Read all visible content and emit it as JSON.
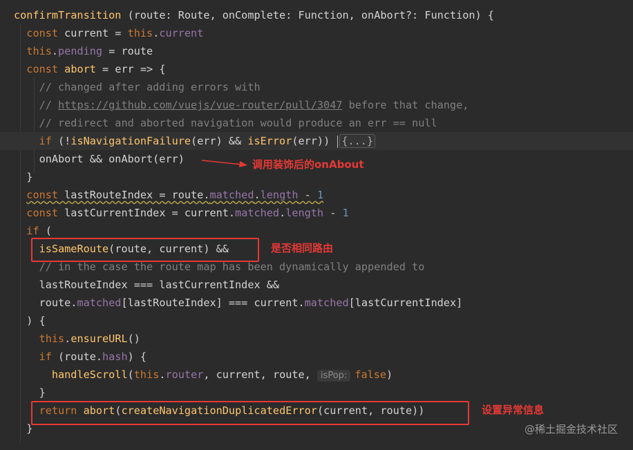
{
  "code_lines": [
    "confirmTransition (route: Route, onComplete: Function, onAbort?: Function) {",
    "  const current = this.current",
    "  this.pending = route",
    "  const abort = err => {",
    "    // changed after adding errors with",
    "    // https://github.com/vuejs/vue-router/pull/3047 before that change,",
    "    // redirect and aborted navigation would produce an err == null",
    "    if (!isNavigationFailure(err) && isError(err)) {...}",
    "    onAbort && onAbort(err)",
    "  }",
    "  const lastRouteIndex = route.matched.length - 1",
    "  const lastCurrentIndex = current.matched.length - 1",
    "  if (",
    "    isSameRoute(route, current) &&",
    "    // in the case the route map has been dynamically appended to",
    "    lastRouteIndex === lastCurrentIndex &&",
    "    route.matched[lastRouteIndex] === current.matched[lastCurrentIndex]",
    "  ) {",
    "    this.ensureURL()",
    "    if (route.hash) {",
    "      handleScroll(this.router, current, route, isPop: false)",
    "    }",
    "    return abort(createNavigationDuplicatedError(current, route))",
    "  }"
  ],
  "annotations": {
    "on_abort": "调用装饰后的onAbout",
    "same_route": "是否相同路由",
    "set_error": "设置异常信息"
  },
  "watermark": "@稀土掘金技术社区",
  "colors": {
    "background": "#2b2b2b",
    "keyword": "#cc7832",
    "function": "#ffc66d",
    "property": "#9876aa",
    "number": "#6897bb",
    "comment": "#808080",
    "annotation": "#e53935"
  }
}
